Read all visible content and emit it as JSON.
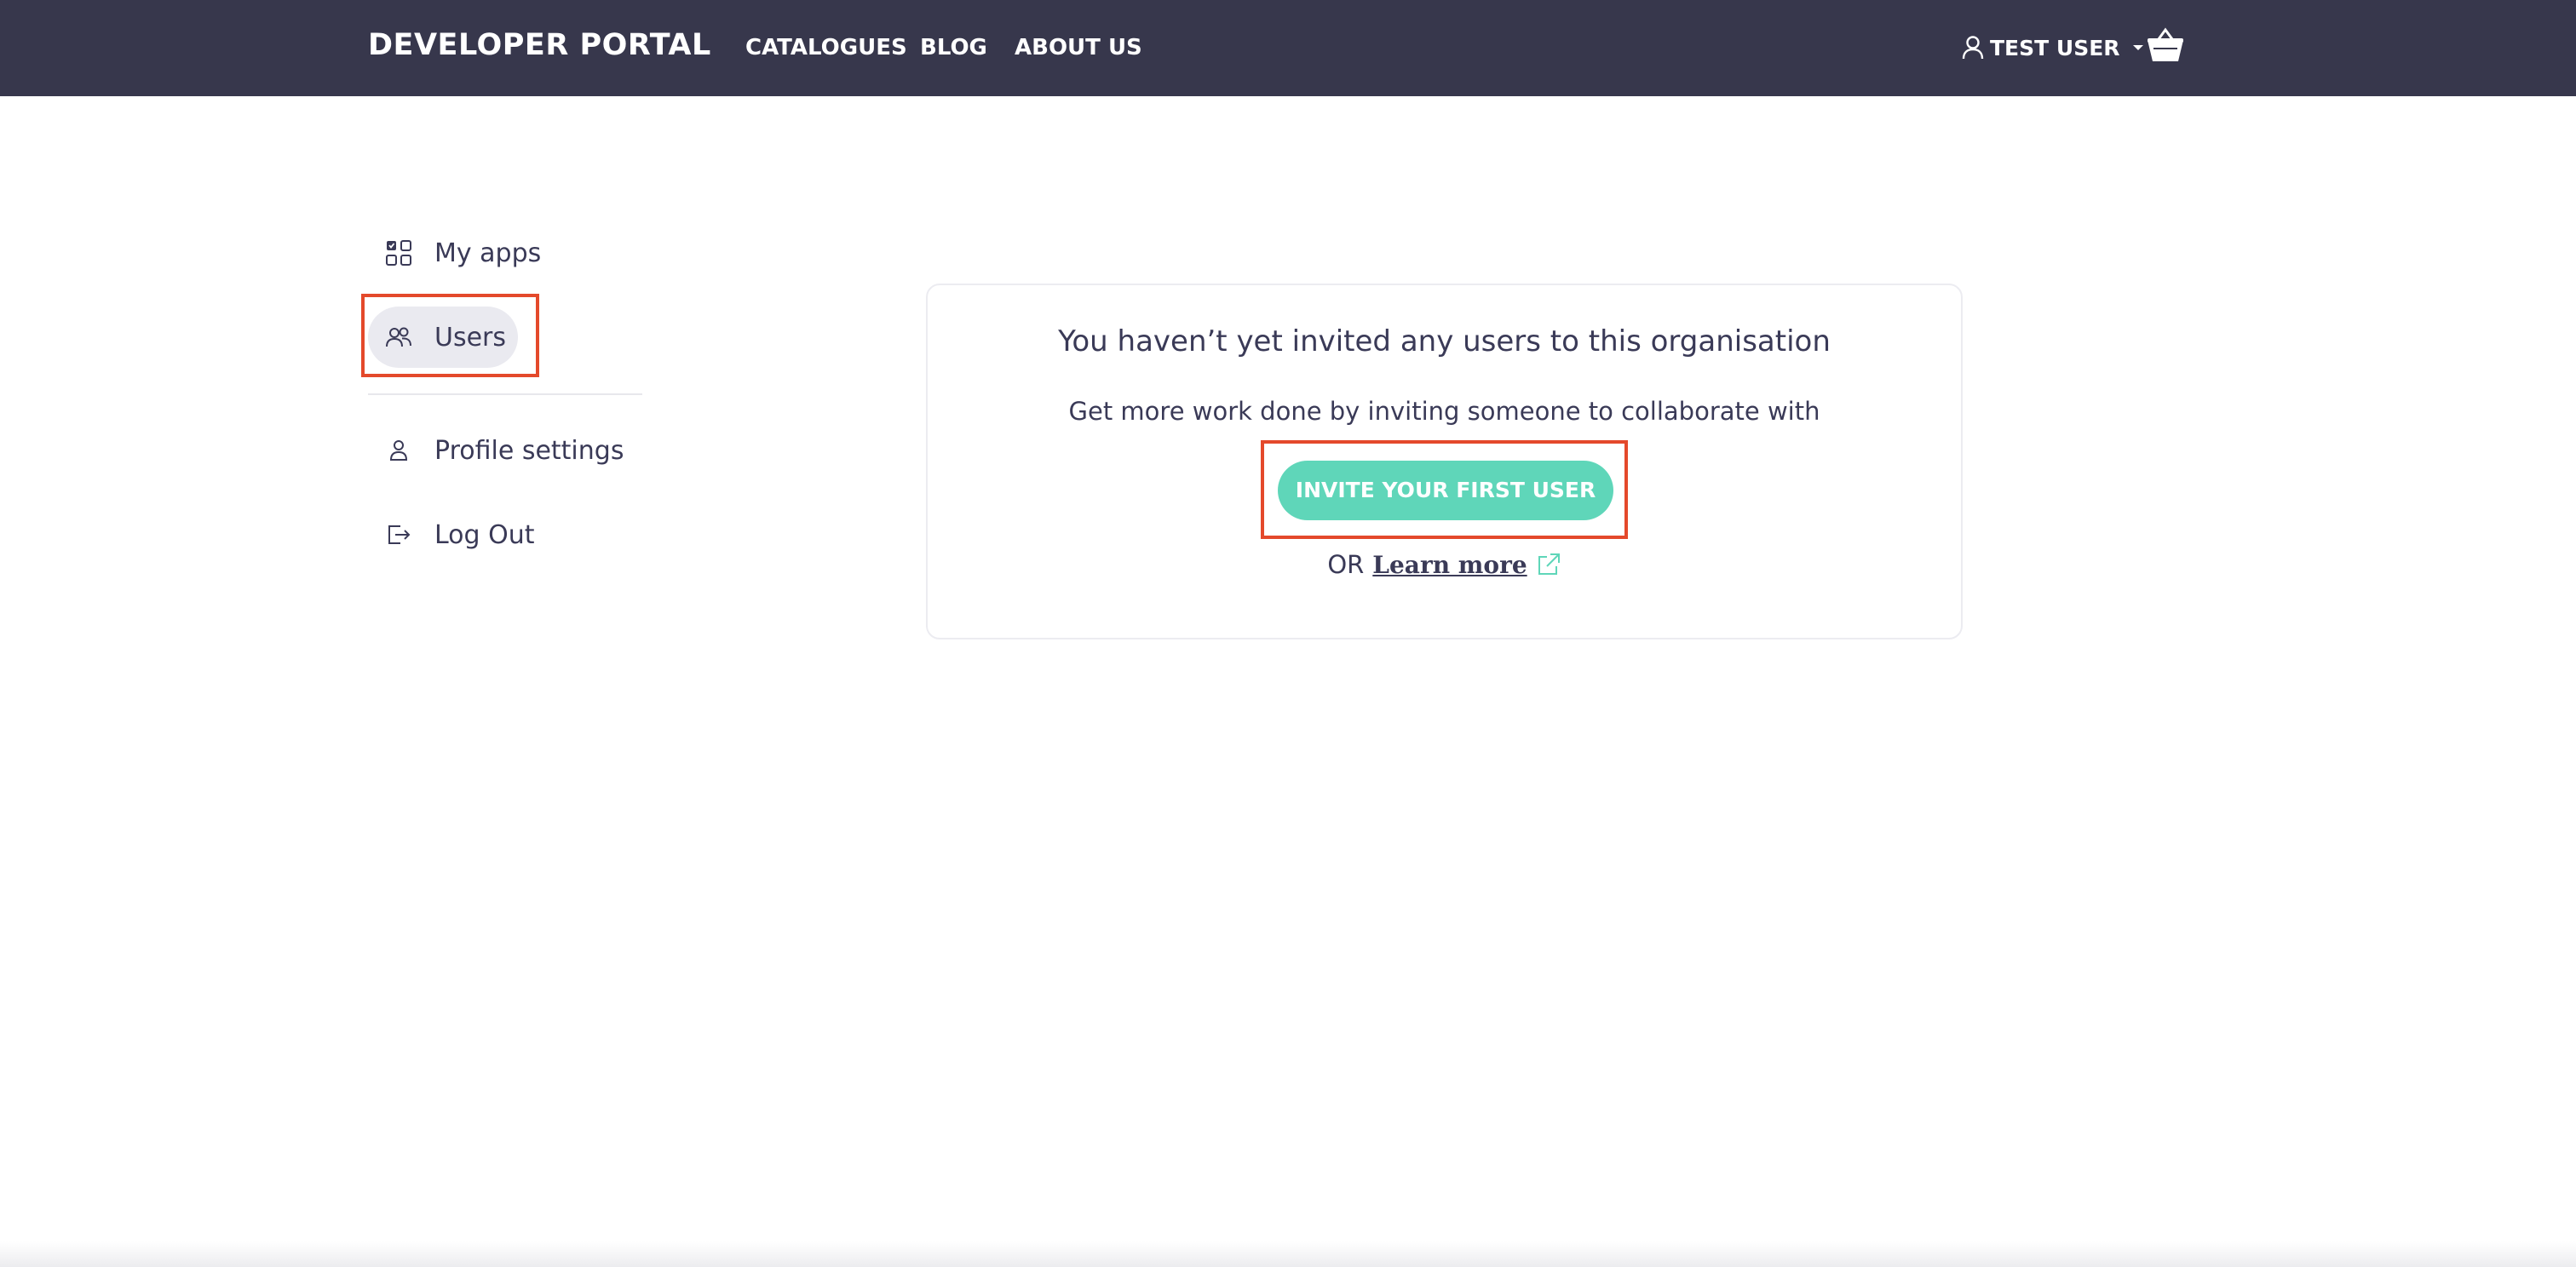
{
  "header": {
    "brand": "DEVELOPER PORTAL",
    "nav": [
      {
        "label": "CATALOGUES"
      },
      {
        "label": "BLOG"
      },
      {
        "label": "ABOUT US"
      }
    ],
    "user_label": "TEST USER",
    "user_icon": "user-icon",
    "cart_icon": "cart-icon"
  },
  "sidebar": {
    "items": [
      {
        "label": "My apps",
        "icon": "apps-grid-icon"
      },
      {
        "label": "Users",
        "icon": "users-icon",
        "active": true
      },
      {
        "label": "Profile settings",
        "icon": "person-icon"
      },
      {
        "label": "Log Out",
        "icon": "logout-icon"
      }
    ]
  },
  "empty_state": {
    "title": "You haven’t yet invited any users to this organisation",
    "subtitle": "Get more work done by inviting someone to collaborate with",
    "invite_label": "INVITE YOUR FIRST USER",
    "or_label": "OR",
    "learn_more_label": "Learn more",
    "external_icon": "external-link-icon"
  },
  "colors": {
    "header_bg": "#37374c",
    "accent": "#5fd6b9",
    "highlight": "#e4492b",
    "text": "#3a3a57",
    "active_item_bg": "#eaeaf0"
  }
}
